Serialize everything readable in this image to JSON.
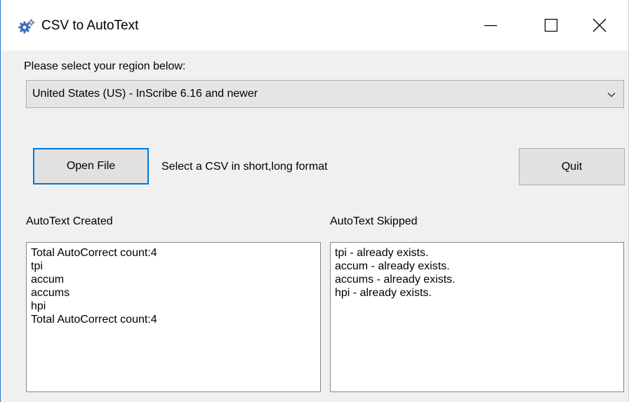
{
  "window": {
    "title": "CSV to AutoText"
  },
  "region": {
    "label": "Please select your region below:",
    "selected": "United States (US) - InScribe 6.16 and newer"
  },
  "actions": {
    "open_file_label": "Open File",
    "instruction": "Select a CSV in short,long format",
    "quit_label": "Quit"
  },
  "created": {
    "heading": "AutoText Created",
    "lines": [
      "Total AutoCorrect count:4",
      "tpi",
      "accum",
      "accums",
      "hpi",
      "Total AutoCorrect count:4"
    ]
  },
  "skipped": {
    "heading": "AutoText Skipped",
    "lines": [
      "tpi - already exists.",
      "accum - already exists.",
      "accums - already exists.",
      "hpi - already exists."
    ]
  },
  "icons": {
    "app": "gears-icon",
    "minimize": "minimize-icon",
    "maximize": "maximize-icon",
    "close": "close-icon",
    "dropdown": "chevron-down-icon"
  }
}
